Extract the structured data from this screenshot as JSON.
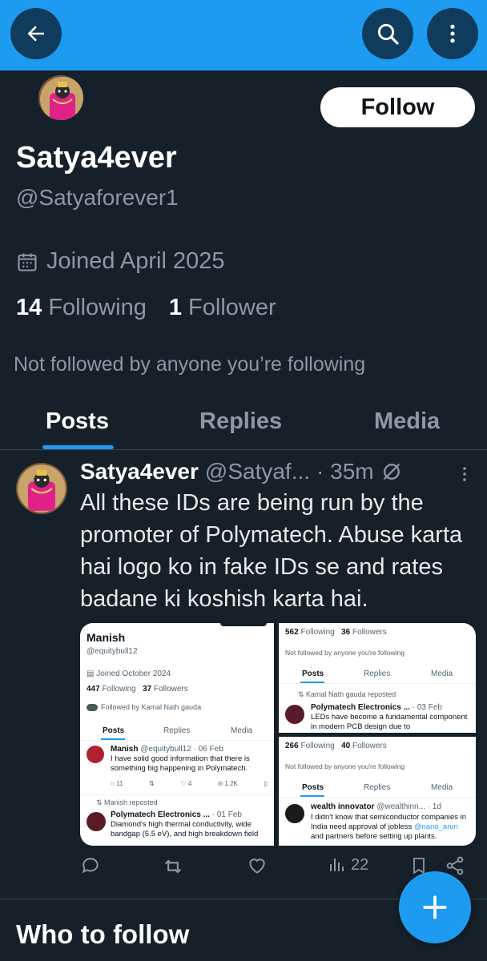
{
  "profile": {
    "name": "Satya4ever",
    "handle": "@Satyaforever1",
    "follow_label": "Follow",
    "joined": "Joined April 2025",
    "following_count": "14",
    "following_label": "Following",
    "followers_count": "1",
    "followers_label": "Follower",
    "not_followed": "Not followed by anyone you’re following"
  },
  "tabs": [
    "Posts",
    "Replies",
    "Media"
  ],
  "active_tab": "Posts",
  "post": {
    "name": "Satya4ever",
    "handle": "@Satyaf...",
    "time": "· 35m",
    "text": "All these IDs are being run by the promoter of Polymatech. Abuse karta hai logo ko in fake IDs se and rates badane ki koshish karta hai.",
    "views": "22"
  },
  "media_left": {
    "name": "Manish",
    "handle": "@equitybull12",
    "joined": "Joined October 2024",
    "following": "447",
    "following_label": "Following",
    "followers": "37",
    "followers_label": "Followers",
    "followed_by": "Followed by Kamal Nath gauda",
    "tabs": [
      "Posts",
      "Replies",
      "Media"
    ],
    "tweet_name": "Manish",
    "tweet_meta": "@equitybull12 · 06 Feb",
    "tweet_text": "I have solid good information that there is something big happening in Polymatech.",
    "tweet_replies": "11",
    "tweet_likes": "4",
    "tweet_views": "1.2K",
    "repost_label": "Manish reposted",
    "repost_name": "Polymatech Electronics ...",
    "repost_meta": "· 01 Feb",
    "repost_text": "Diamond's high thermal conductivity, wide bandgap (5.5 eV), and high breakdown field"
  },
  "media_right_top": {
    "following": "562",
    "following_label": "Following",
    "followers": "36",
    "followers_label": "Followers",
    "not_followed": "Not followed by anyone you're following",
    "tabs": [
      "Posts",
      "Replies",
      "Media"
    ],
    "repost_label": "Kamal Nath gauda reposted",
    "tweet_name": "Polymatech Electronics ...",
    "tweet_meta": "· 03 Feb",
    "tweet_text": "LEDs have become a fundamental component in modern PCB design due to"
  },
  "media_right_bottom": {
    "following": "266",
    "following_label": "Following",
    "followers": "40",
    "followers_label": "Followers",
    "not_followed": "Not followed by anyone you're following",
    "tabs": [
      "Posts",
      "Replies",
      "Media"
    ],
    "tweet_name": "wealth innovator",
    "tweet_meta": "@wealthinn... · 1d",
    "tweet_text_1": "I didn't know that semiconductor companies in India need approval of jobless",
    "tweet_mention": "@nano_arun",
    "tweet_text_2": "and partners before setting up plants."
  },
  "who_to_follow": "Who to follow",
  "icons": {
    "back": "back-arrow-icon",
    "search": "search-icon",
    "more": "more-vertical-icon",
    "calendar": "calendar-icon",
    "reply": "reply-icon",
    "repost": "repost-icon",
    "like": "like-icon",
    "views": "views-icon",
    "bookmark": "bookmark-icon",
    "share": "share-icon",
    "compose": "compose-plus-icon"
  },
  "colors": {
    "background": "#15202b",
    "accent": "#1d9bf0",
    "text": "#e7e9ea",
    "muted": "#8b98a5"
  }
}
